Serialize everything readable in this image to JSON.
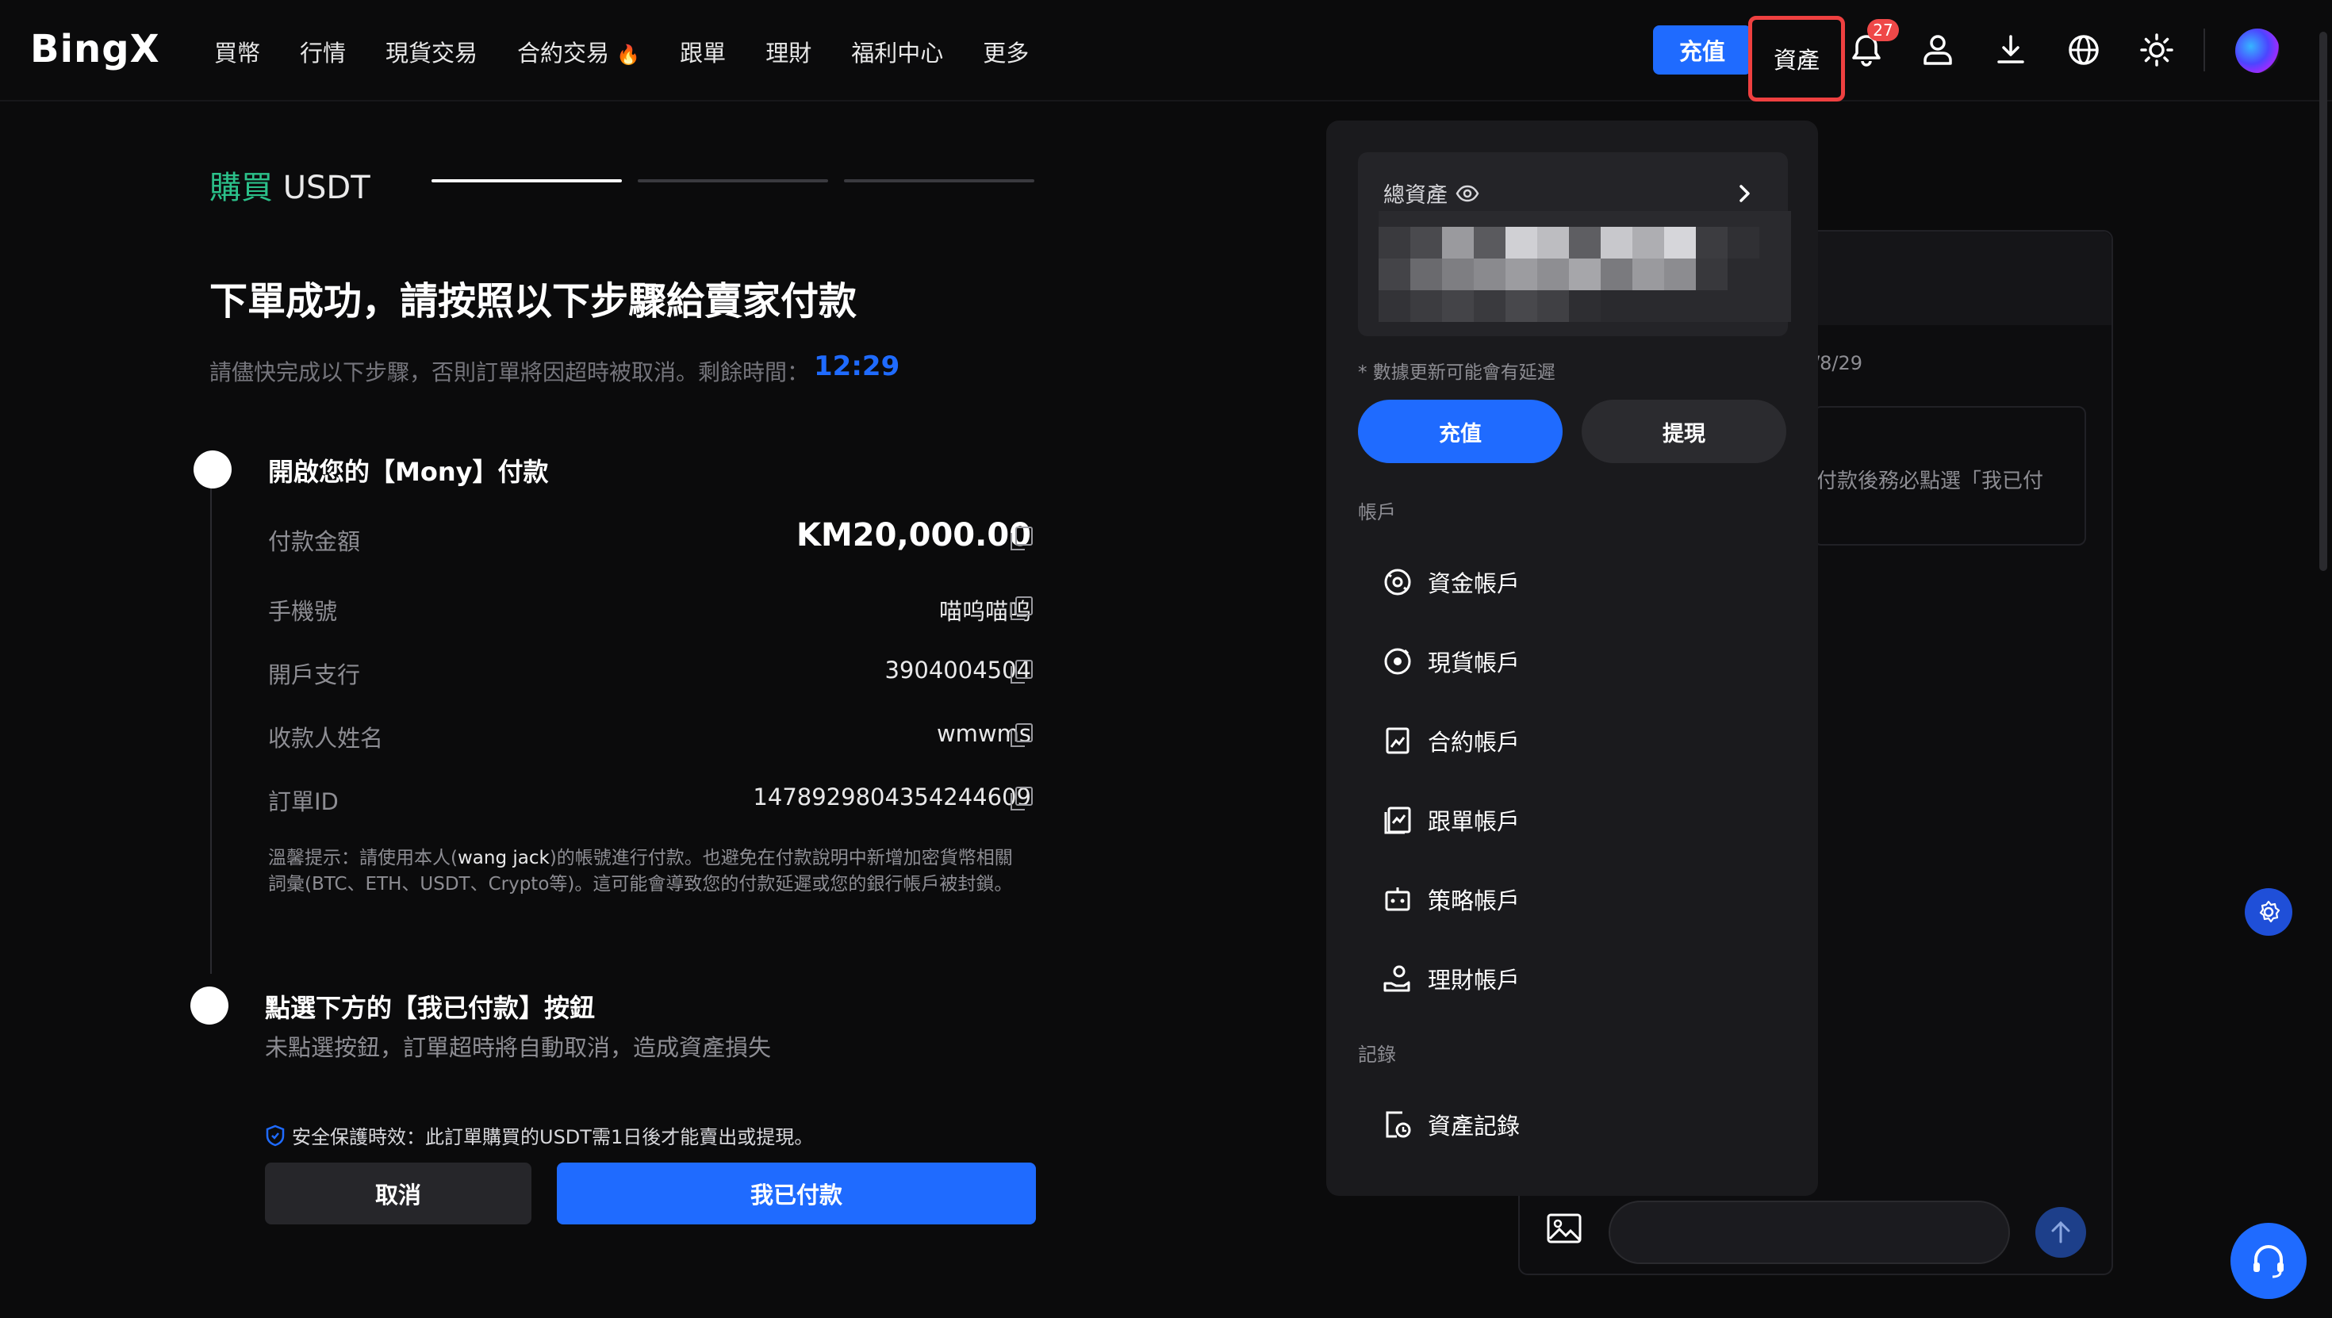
{
  "header": {
    "logo": "BingX",
    "nav": [
      "買幣",
      "行情",
      "現貨交易",
      "合約交易",
      "跟單",
      "理財",
      "福利中心",
      "更多"
    ],
    "deposit_label": "充值",
    "assets_label": "資產",
    "notification_count": "27"
  },
  "order": {
    "title_action": "購買",
    "title_asset": "USDT",
    "headline": "下單成功，請按照以下步驟給賣家付款",
    "subtitle": "請儘快完成以下步驟，否則訂單將因超時被取消。剩餘時間：",
    "time_left": "12:29",
    "step1_title": "開啟您的【Mony】付款",
    "rows": [
      {
        "label": "付款金額",
        "value": "KM20,000.00"
      },
      {
        "label": "手機號",
        "value": "喵呜喵呜"
      },
      {
        "label": "開戶支行",
        "value": "3904004504"
      },
      {
        "label": "收款人姓名",
        "value": "wmwms"
      },
      {
        "label": "訂單ID",
        "value": "1478929804354244609"
      }
    ],
    "tip_prefix": "溫馨提示：請使用本人(",
    "tip_name": "wang jack",
    "tip_suffix": ")的帳號進行付款。也避免在付款說明中新增加密貨幣相關詞彙(BTC、ETH、USDT、Crypto等)。這可能會導致您的付款延遲或您的銀行帳戶被封鎖。",
    "step2_title": "點選下方的【我已付款】按鈕",
    "step2_sub": "未點選按鈕，訂單超時將自動取消，造成資產損失",
    "safety_text": "安全保護時效：此訂單購買的USDT需1日後才能賣出或提現。",
    "cancel_label": "取消",
    "paid_label": "我已付款"
  },
  "chat": {
    "date_fragment": "/8/29",
    "message_fragment": "付款後務必點選「我已付"
  },
  "assets_dropdown": {
    "total_label": "總資產",
    "note": "* 數據更新可能會有延遲",
    "deposit_label": "充值",
    "withdraw_label": "提現",
    "accounts_section": "帳戶",
    "accounts": [
      "資金帳戶",
      "現貨帳戶",
      "合約帳戶",
      "跟單帳戶",
      "策略帳戶",
      "理財帳戶"
    ],
    "records_section": "記錄",
    "records": [
      "資產記錄"
    ]
  },
  "colors": {
    "accent": "#1f6bff",
    "green": "#2bc08a",
    "highlight_border": "#ef4040"
  }
}
